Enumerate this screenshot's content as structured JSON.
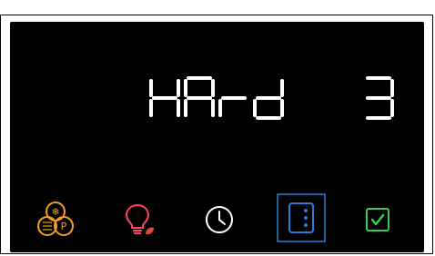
{
  "display": {
    "mode_text": "HArd",
    "level_text": "3"
  },
  "colors": {
    "screen_bg": "#000000",
    "segment": "#ffffff",
    "functions_icon": "#f0a020",
    "light_icon": "#ff4060",
    "leaf": "#e0483a",
    "clock_icon": "#ffffff",
    "menu_icon": "#2b7fd6",
    "confirm_icon": "#33cc55"
  },
  "icons": [
    {
      "name": "functions-icon",
      "label": "❄ P"
    },
    {
      "name": "light-eco-icon"
    },
    {
      "name": "clock-icon"
    },
    {
      "name": "menu-icon"
    },
    {
      "name": "confirm-icon"
    }
  ]
}
